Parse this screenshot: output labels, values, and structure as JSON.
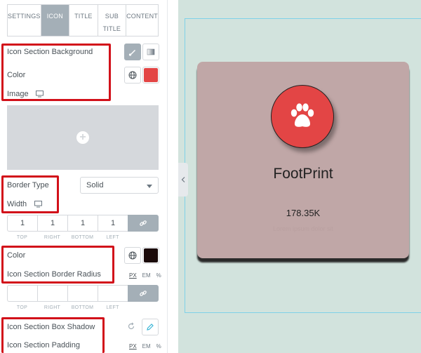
{
  "tabs": [
    {
      "label": "SETTINGS",
      "active": false
    },
    {
      "label": "ICON",
      "active": true
    },
    {
      "label": "TITLE",
      "active": false
    },
    {
      "label": "SUB",
      "label2": "TITLE",
      "active": false
    },
    {
      "label": "CONTENT",
      "active": false
    }
  ],
  "controls": {
    "icon_bg_label": "Icon Section Background",
    "color_label": "Color",
    "image_label": "Image",
    "border_type_label": "Border Type",
    "border_type_value": "Solid",
    "width_label": "Width",
    "width_values": [
      "1",
      "1",
      "1",
      "1"
    ],
    "dim_labels": [
      "TOP",
      "RIGHT",
      "BOTTOM",
      "LEFT"
    ],
    "border_color_label": "Color",
    "border_radius_label": "Icon Section Border Radius",
    "radius_values": [
      "",
      "",
      "",
      ""
    ],
    "box_shadow_label": "Icon Section Box Shadow",
    "padding_label": "Icon Section Padding",
    "units": [
      "PX",
      "EM",
      "%"
    ],
    "bg_color": "#e34545",
    "border_color": "#1a0a0a"
  },
  "preview": {
    "title": "FootPrint",
    "value": "178.35K",
    "subtitle": "Lorem ipsum dolor sit",
    "icon": "paw-icon",
    "card_color": "#c0a7a7",
    "icon_color": "#e34545"
  }
}
